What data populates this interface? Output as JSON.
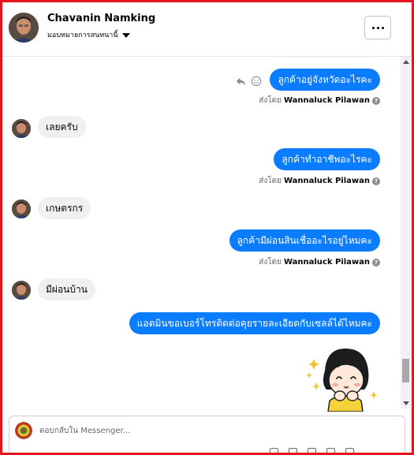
{
  "header": {
    "contact_name": "Chavanin Namking",
    "assign_label": "มอบหมายการสนทนานี้",
    "more_label": "..."
  },
  "messages": [
    {
      "direction": "outgoing",
      "text": "ลูกค้าอยู่จังหวัดอะไรคะ",
      "sent_by_prefix": "ส่งโดย",
      "sent_by_name": "Wannaluck Pilawan"
    },
    {
      "direction": "incoming",
      "text": "เลยครับ"
    },
    {
      "direction": "outgoing",
      "text": "ลูกค้าทำอาชีพอะไรคะ",
      "sent_by_prefix": "ส่งโดย",
      "sent_by_name": "Wannaluck Pilawan"
    },
    {
      "direction": "incoming",
      "text": "เกษตรกร"
    },
    {
      "direction": "outgoing",
      "text": "ลูกค้ามีผ่อนสินเชื่ออะไรอยู่ไหมคะ",
      "sent_by_prefix": "ส่งโดย",
      "sent_by_name": "Wannaluck Pilawan"
    },
    {
      "direction": "incoming",
      "text": "มีผ่อนบ้าน"
    },
    {
      "direction": "outgoing",
      "text": "แอดมินขอเบอร์โทรติดต่อคุยรายละเอียดกับเซลล์ได้ไหมคะ"
    }
  ],
  "icons": {
    "help": "?",
    "reply": "reply-icon",
    "react": "smiley-icon",
    "sticker": "girl-sticker"
  },
  "composer": {
    "placeholder": "ตอบกลับใน Messenger..."
  },
  "colors": {
    "outgoing_bubble": "#0a7cff",
    "incoming_bubble": "#f0f0f0",
    "frame_border": "#e4161c"
  }
}
